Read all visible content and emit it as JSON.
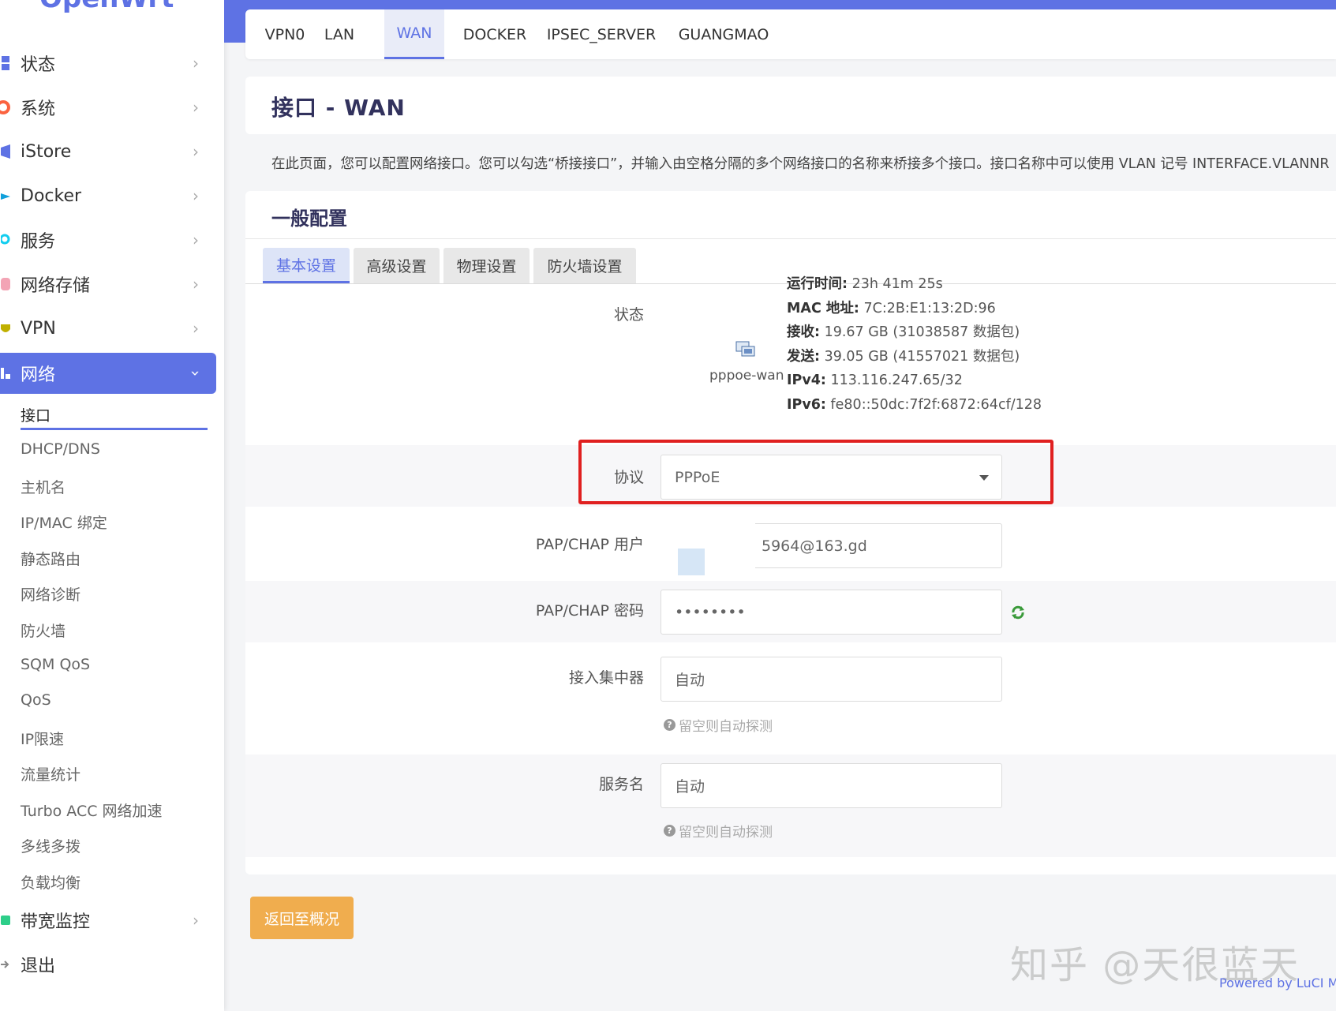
{
  "logo": "OpenWrt",
  "sidebar": {
    "items": [
      {
        "label": "状态",
        "icon": "dashboard-icon",
        "color": "#5e72e4"
      },
      {
        "label": "系统",
        "icon": "gear-icon",
        "color": "#fb6340"
      },
      {
        "label": "iStore",
        "icon": "cube-icon",
        "color": "#5e72e4"
      },
      {
        "label": "Docker",
        "icon": "docker-icon",
        "color": "#11a0db"
      },
      {
        "label": "服务",
        "icon": "services-icon",
        "color": "#11cdef"
      },
      {
        "label": "网络存储",
        "icon": "database-icon",
        "color": "#f3a4b5"
      },
      {
        "label": "VPN",
        "icon": "vpn-icon",
        "color": "#c0b000"
      }
    ],
    "network": {
      "label": "网络",
      "icon": "network-icon"
    },
    "sub_items": [
      "接口",
      "DHCP/DNS",
      "主机名",
      "IP/MAC 绑定",
      "静态路由",
      "网络诊断",
      "防火墙",
      "SQM QoS",
      "QoS",
      "IP限速",
      "流量统计",
      "Turbo ACC 网络加速",
      "多线多拨",
      "负载均衡"
    ],
    "bandwidth": {
      "label": "带宽监控",
      "icon": "monitor-icon"
    },
    "logout": {
      "label": "退出",
      "icon": "logout-icon"
    }
  },
  "top_tabs": [
    "VPN0",
    "LAN",
    "WAN",
    "DOCKER",
    "IPSEC_SERVER",
    "GUANGMAO"
  ],
  "top_tabs_active": "WAN",
  "page_title": "接口 - WAN",
  "description": "在此页面，您可以配置网络接口。您可以勾选“桥接接口”，并输入由空格分隔的多个网络接口的名称来桥接多个接口。接口名称中可以使用 VLAN 记号 INTERFACE.VLANNR（例如",
  "section_title": "一般配置",
  "sub_tabs": [
    "基本设置",
    "高级设置",
    "物理设置",
    "防火墙设置"
  ],
  "status": {
    "label": "状态",
    "iface": "pppoe-wan",
    "uptime_label": "运行时间:",
    "uptime": "23h 41m 25s",
    "mac_label": "MAC 地址:",
    "mac": "7C:2B:E1:13:2D:96",
    "rx_label": "接收:",
    "rx": "19.67 GB (31038587 数据包)",
    "tx_label": "发送:",
    "tx": "39.05 GB (41557021 数据包)",
    "ipv4_label": "IPv4:",
    "ipv4": "113.116.247.65/32",
    "ipv6_label": "IPv6:",
    "ipv6": "fe80::50dc:7f2f:6872:64cf/128"
  },
  "protocol": {
    "label": "协议",
    "value": "PPPoE"
  },
  "username": {
    "label": "PAP/CHAP 用户",
    "value": "5964@163.gd"
  },
  "password": {
    "label": "PAP/CHAP 密码",
    "value": "••••••••"
  },
  "concentrator": {
    "label": "接入集中器",
    "placeholder": "自动",
    "hint": "留空则自动探测"
  },
  "service": {
    "label": "服务名",
    "placeholder": "自动",
    "hint": "留空则自动探测"
  },
  "back_button": "返回至概况",
  "watermark": "知乎 @天很蓝天",
  "powered_by": "Powered by LuCI M",
  "colors": {
    "accent": "#5e72e4",
    "warning": "#f0ad4e",
    "highlight": "#e02020"
  }
}
